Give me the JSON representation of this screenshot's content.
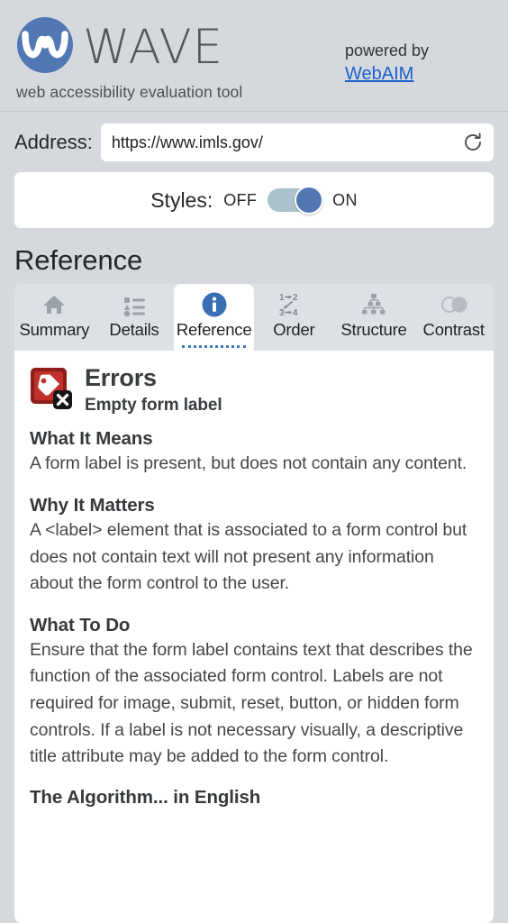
{
  "header": {
    "logo_icon": "wave-logo-icon",
    "wordmark": "WAVE",
    "tagline": "web accessibility evaluation tool",
    "powered_by_label": "powered by",
    "powered_by_link": "WebAIM"
  },
  "address": {
    "label": "Address:",
    "value": "https://www.imls.gov/",
    "placeholder": "Enter a web page address",
    "reload_icon": "reload-icon"
  },
  "styles": {
    "label": "Styles:",
    "off_label": "OFF",
    "on_label": "ON",
    "state": "ON"
  },
  "section": {
    "title": "Reference"
  },
  "tabs": [
    {
      "label": "Summary",
      "icon": "home-icon",
      "active": false
    },
    {
      "label": "Details",
      "icon": "list-icon",
      "active": false
    },
    {
      "label": "Reference",
      "icon": "info-icon",
      "active": true
    },
    {
      "label": "Order",
      "icon": "order-icon",
      "active": false
    },
    {
      "label": "Structure",
      "icon": "structure-icon",
      "active": false
    },
    {
      "label": "Contrast",
      "icon": "contrast-icon",
      "active": false
    }
  ],
  "order_icon_text": {
    "top": "1→2",
    "bottom": "3→4"
  },
  "reference": {
    "category": "Errors",
    "item_name": "Empty form label",
    "icon": "error-tag-icon",
    "sections": [
      {
        "heading": "What It Means",
        "body": "A form label is present, but does not contain any content."
      },
      {
        "heading": "Why It Matters",
        "body": "A <label> element that is associated to a form control but does not contain text will not present any information about the form control to the user."
      },
      {
        "heading": "What To Do",
        "body": "Ensure that the form label contains text that describes the function of the associated form control. Labels are not required for image, submit, reset, button, or hidden form controls. If a label is not necessary visually, a descriptive title attribute may be added to the form control."
      }
    ],
    "next_heading": "The Algorithm... in English"
  },
  "colors": {
    "page_background": "#d5d9dd",
    "panel_white": "#ffffff",
    "tabbar_background": "#dde1e5",
    "accent_blue": "#3b78c3",
    "logo_blue": "#5278b4",
    "link_blue": "#1b5fd0",
    "error_red": "#b32020",
    "toggle_track": "#a9c2cc"
  }
}
